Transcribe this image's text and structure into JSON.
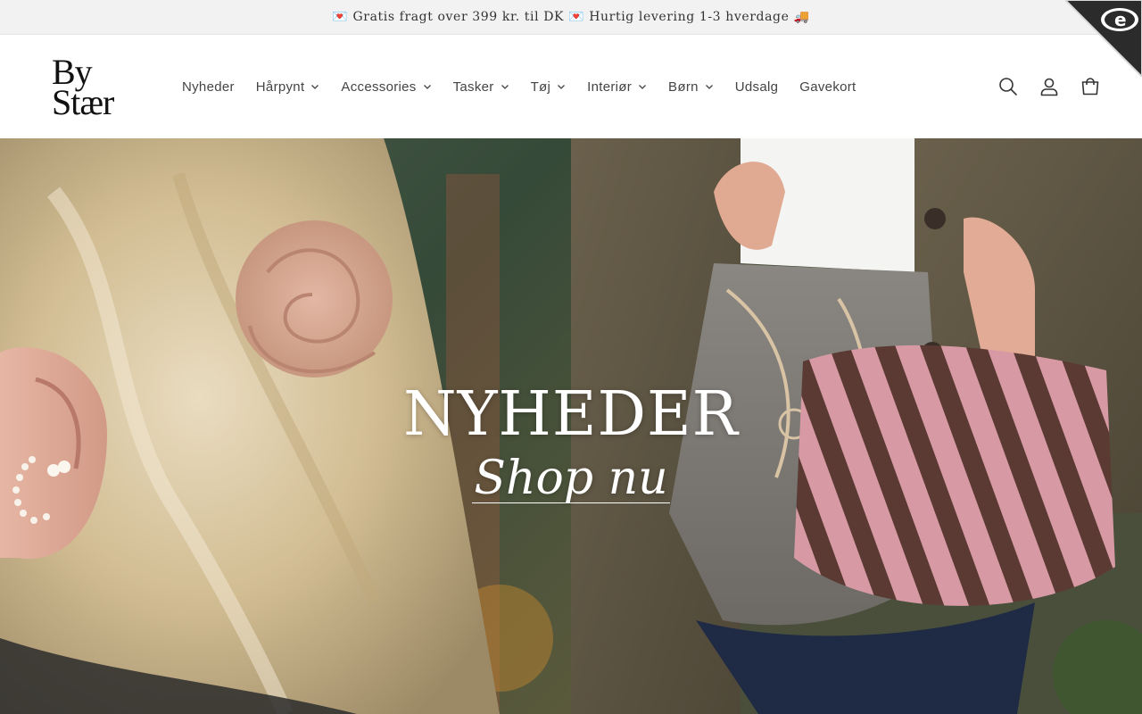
{
  "announcement": {
    "text": "💌 Gratis fragt over 399 kr. til DK 💌 Hurtig levering 1-3 hverdage 🚚"
  },
  "brand": {
    "logo_line1": "By",
    "logo_line2": "Stær"
  },
  "nav": {
    "items": [
      {
        "label": "Nyheder",
        "has_dropdown": false
      },
      {
        "label": "Hårpynt",
        "has_dropdown": true
      },
      {
        "label": "Accessories",
        "has_dropdown": true
      },
      {
        "label": "Tasker",
        "has_dropdown": true
      },
      {
        "label": "Tøj",
        "has_dropdown": true
      },
      {
        "label": "Interiør",
        "has_dropdown": true
      },
      {
        "label": "Børn",
        "has_dropdown": true
      },
      {
        "label": "Udsalg",
        "has_dropdown": false
      },
      {
        "label": "Gavekort",
        "has_dropdown": false
      }
    ]
  },
  "header_icons": [
    "search-icon",
    "account-icon",
    "cart-icon"
  ],
  "hero": {
    "title": "NYHEDER",
    "cta": "Shop nu"
  },
  "colors": {
    "announcement_bg": "#f2f2f2",
    "text": "#444444",
    "hero_text": "#ffffff"
  }
}
